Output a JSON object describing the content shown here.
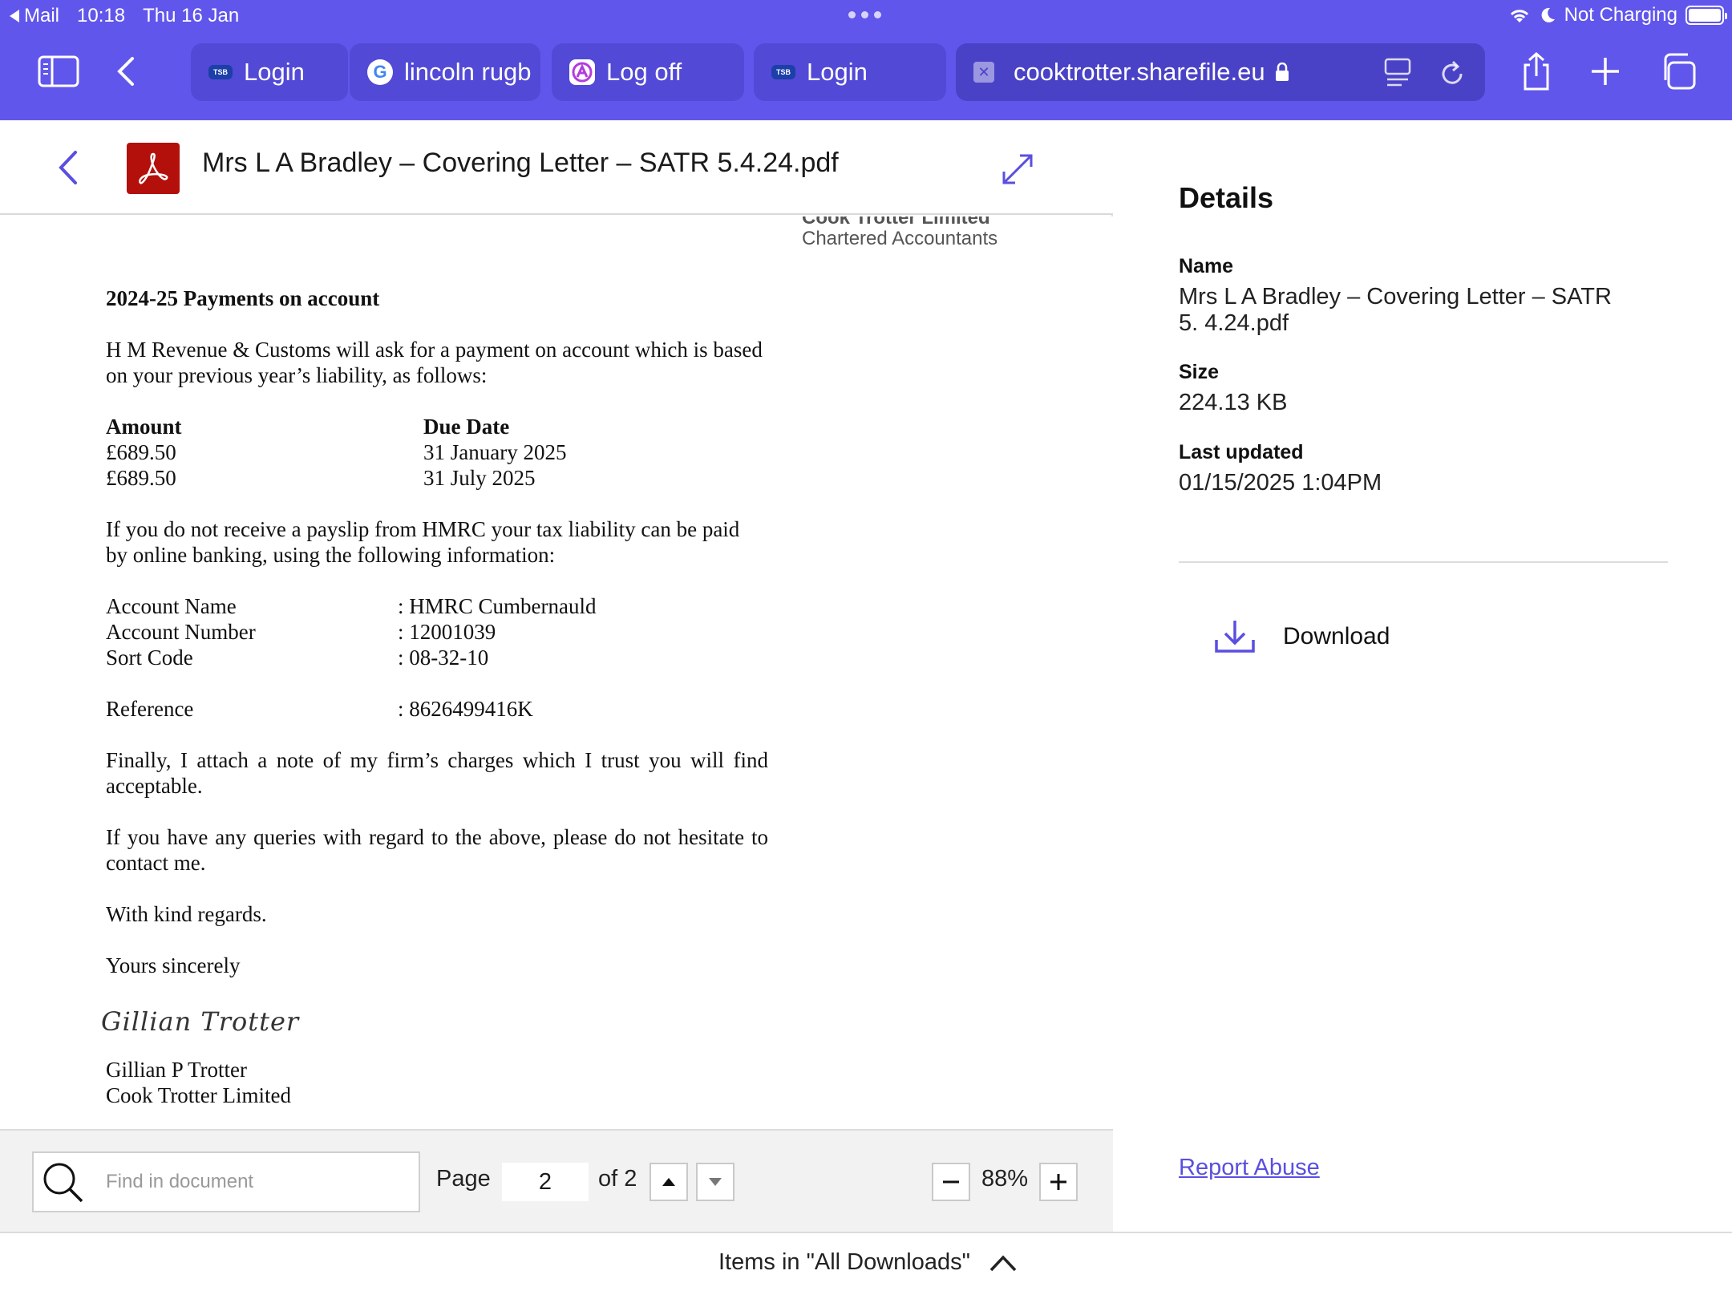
{
  "status_bar": {
    "back_app": "Mail",
    "time": "10:18",
    "date": "Thu 16 Jan",
    "charging": "Not Charging"
  },
  "tabs": [
    {
      "label": "Login",
      "favicon": "tsb-icon"
    },
    {
      "label": "lincoln rugb",
      "favicon": "google-icon"
    },
    {
      "label": "Log off",
      "favicon": "a-logo-icon"
    },
    {
      "label": "Login",
      "favicon": "tsb-icon"
    }
  ],
  "address_bar": {
    "url": "cooktrotter.sharefile.eu"
  },
  "document": {
    "title": "Mrs L A Bradley – Covering Letter – SATR 5.4.24.pdf",
    "company_name": "Cook Trotter Limited",
    "company_sub": "Chartered Accountants",
    "heading": "2024-25 Payments on account",
    "para1_l1": "H M Revenue & Customs will ask for a payment on account which is based",
    "para1_l2": "on your previous year’s liability, as follows:",
    "table": {
      "col_amount": "Amount",
      "col_due": "Due Date",
      "rows": [
        {
          "amount": "£689.50",
          "due": "31 January 2025"
        },
        {
          "amount": "£689.50",
          "due": "31 July 2025"
        }
      ]
    },
    "para2_l1": "If you do not receive a payslip from HMRC your tax liability can be paid",
    "para2_l2": "by online banking, using the following information:",
    "bank": [
      {
        "label": "Account Name",
        "value": ": HMRC Cumbernauld"
      },
      {
        "label": "Account Number",
        "value": ": 12001039"
      },
      {
        "label": "Sort Code",
        "value": ": 08-32-10"
      }
    ],
    "reference_label": "Reference",
    "reference_value": ": 8626499416K",
    "para3_l1": "Finally, I attach a note of my firm’s charges which I trust you will find",
    "para3_l2": "acceptable.",
    "para4_l1": "If you have any queries with regard to the above, please do not hesitate to",
    "para4_l2": "contact me.",
    "regards": "With kind regards.",
    "sincerely": "Yours sincerely",
    "signature": "Gillian Trotter",
    "signatory": "Gillian P Trotter",
    "signatory_company": "Cook Trotter Limited"
  },
  "find_bar": {
    "placeholder": "Find in document",
    "page_label": "Page",
    "page_current": "2",
    "page_total": "of 2",
    "zoom": "88%"
  },
  "details": {
    "heading": "Details",
    "name_label": "Name",
    "name_value": "Mrs L A Bradley – Covering Letter – SATR 5. 4.24.pdf",
    "size_label": "Size",
    "size_value": "224.13 KB",
    "updated_label": "Last updated",
    "updated_value": "01/15/2025 1:04PM",
    "download_label": "Download",
    "report_label": "Report Abuse"
  },
  "bottom_bar": {
    "label": "Items in \"All Downloads\""
  },
  "colors": {
    "chrome": "#6156ec",
    "accent": "#5a4fe0",
    "pdf_red": "#b3100c"
  }
}
